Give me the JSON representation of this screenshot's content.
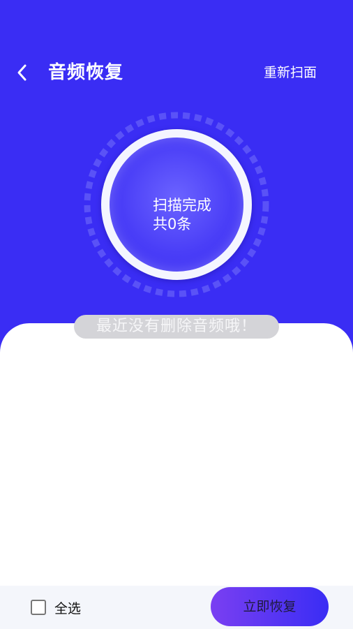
{
  "header": {
    "back_icon": "chevron-left-icon",
    "title": "音频恢复",
    "rescan_label": "重新扫面"
  },
  "scan": {
    "status": "扫描完成",
    "count": "共0条"
  },
  "empty_message": "最近没有删除音频哦！",
  "footer": {
    "select_all_label": "全选",
    "select_all_checked": false,
    "restore_label": "立即恢复"
  },
  "colors": {
    "primary": "#3a2df4",
    "button_gradient_start": "#7a3ff2",
    "button_gradient_end": "#3a2df4",
    "banner_bg": "#d4d4d8",
    "footer_bg": "#f4f6fb"
  }
}
